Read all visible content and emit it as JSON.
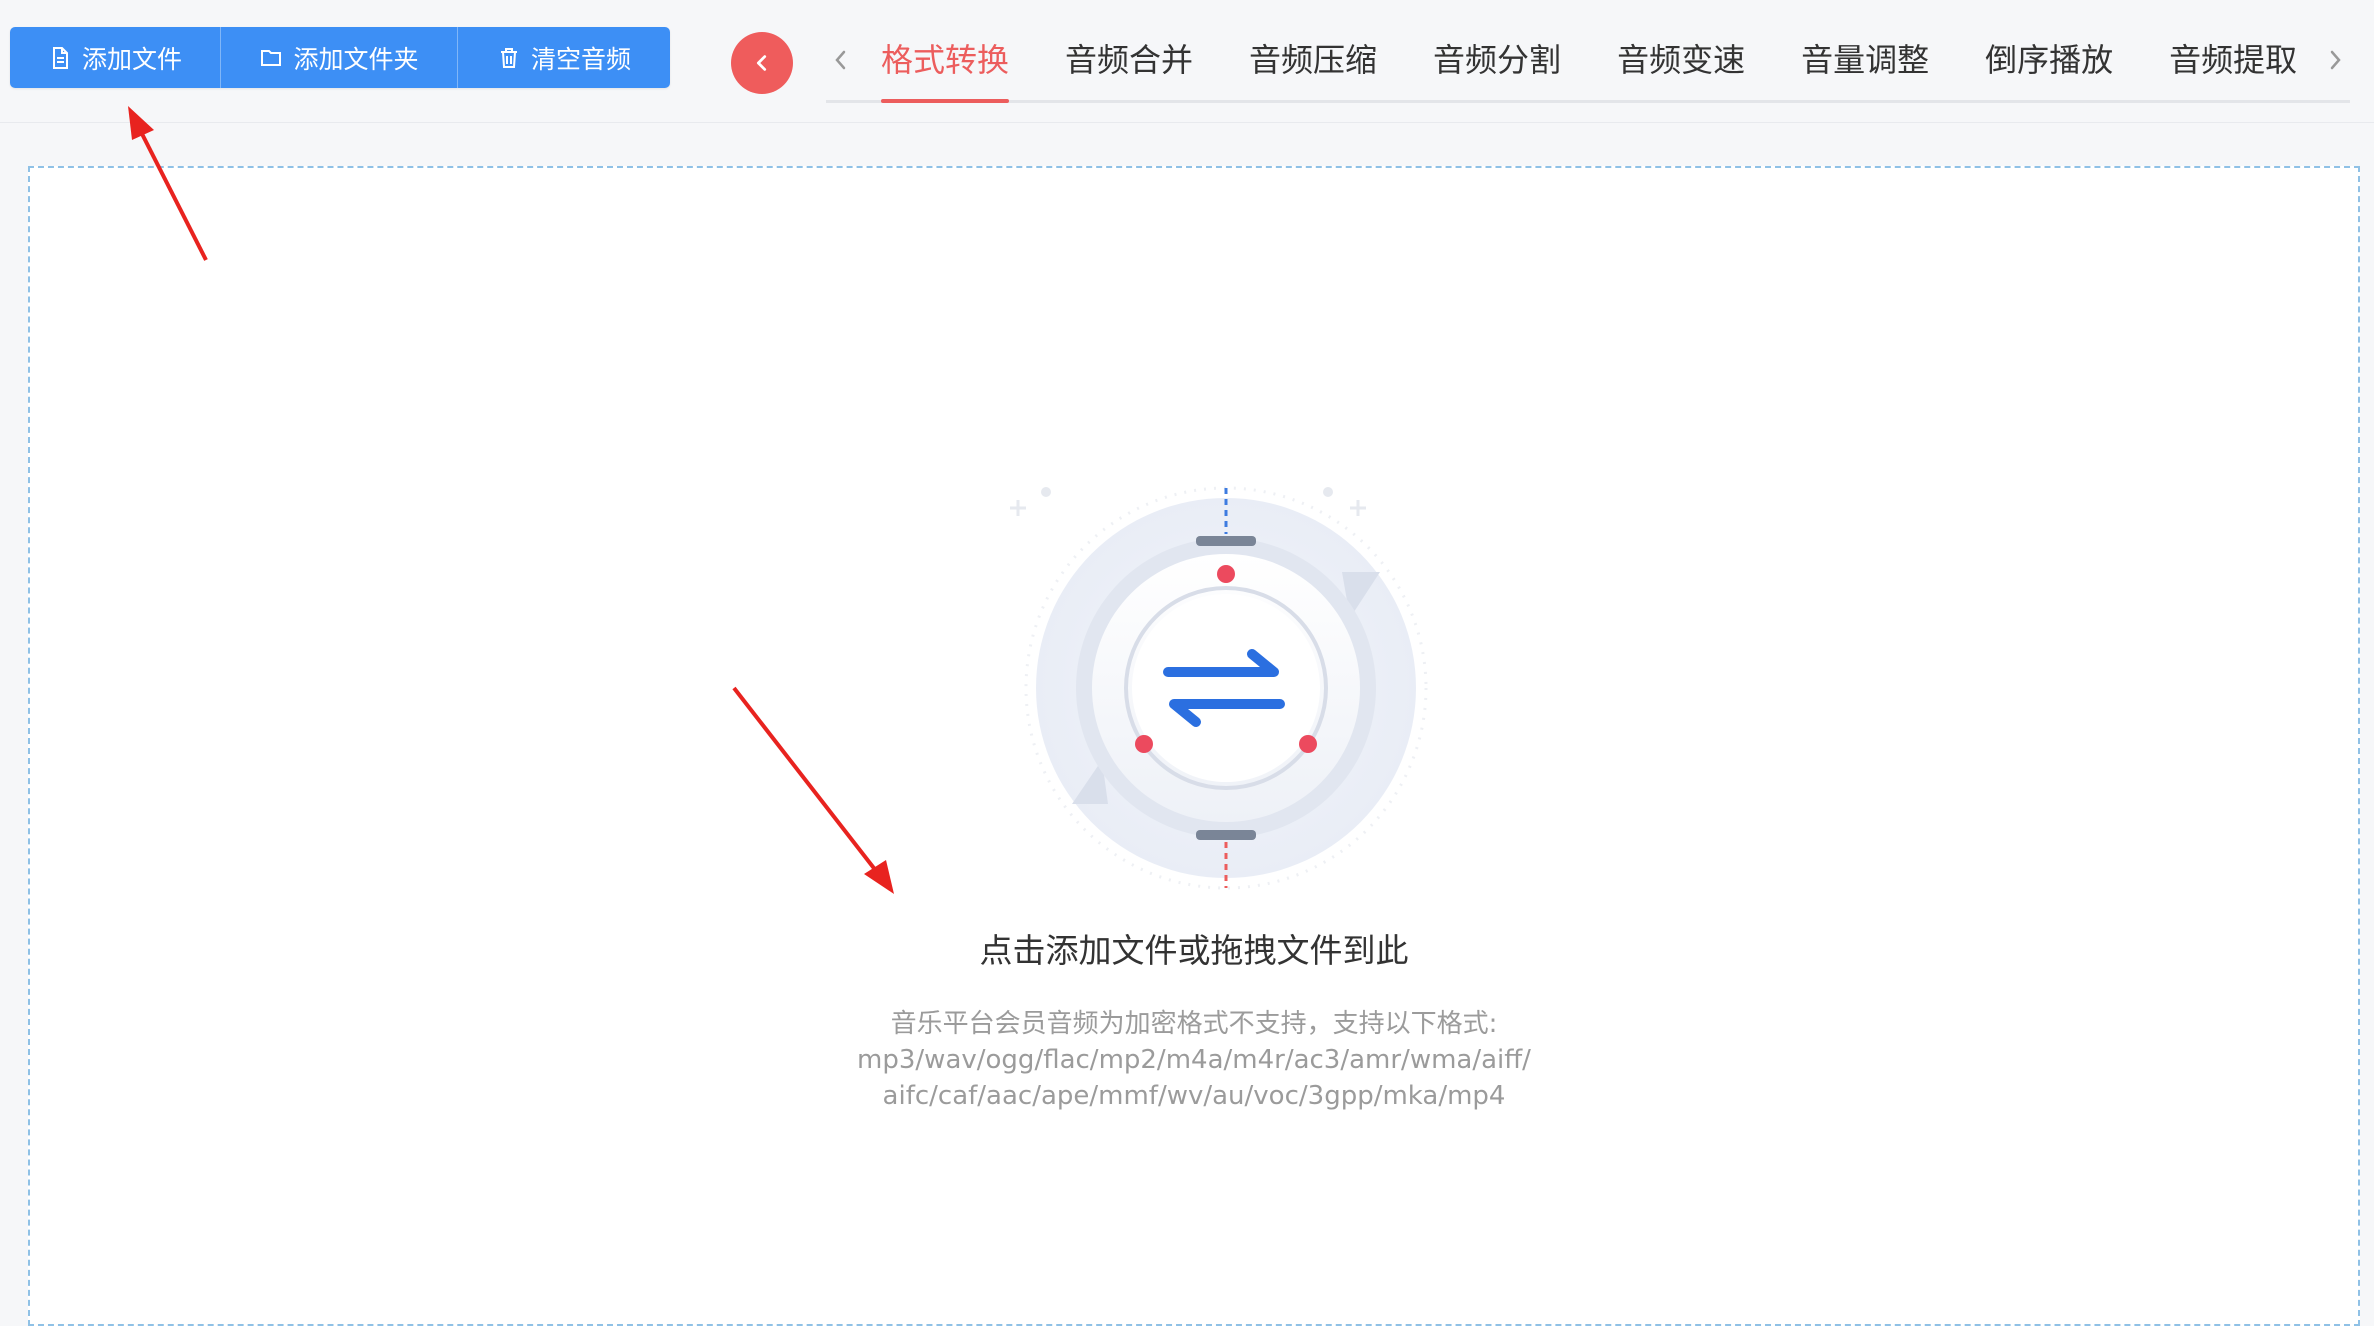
{
  "toolbar": {
    "add_file": "添加文件",
    "add_folder": "添加文件夹",
    "clear_audio": "清空音频"
  },
  "tabs": [
    {
      "label": "格式转换",
      "active": true
    },
    {
      "label": "音频合并",
      "active": false
    },
    {
      "label": "音频压缩",
      "active": false
    },
    {
      "label": "音频分割",
      "active": false
    },
    {
      "label": "音频变速",
      "active": false
    },
    {
      "label": "音量调整",
      "active": false
    },
    {
      "label": "倒序播放",
      "active": false
    },
    {
      "label": "音频提取",
      "active": false
    }
  ],
  "dropzone": {
    "title": "点击添加文件或拖拽文件到此",
    "hint_line1": "音乐平台会员音频为加密格式不支持，支持以下格式:",
    "hint_line2": "mp3/wav/ogg/flac/mp2/m4a/m4r/ac3/amr/wma/aiff/",
    "hint_line3": "aifc/caf/aac/ape/mmf/wv/au/voc/3gpp/mka/mp4"
  },
  "colors": {
    "primary": "#3d8ff5",
    "accent": "#ec5d5d",
    "dropzone_border": "#8fc1e6"
  },
  "icons": {
    "add_file": "file-icon",
    "add_folder": "folder-icon",
    "clear": "trash-icon",
    "back": "chevron-left-icon",
    "illustration": "swap-arrows-icon"
  }
}
